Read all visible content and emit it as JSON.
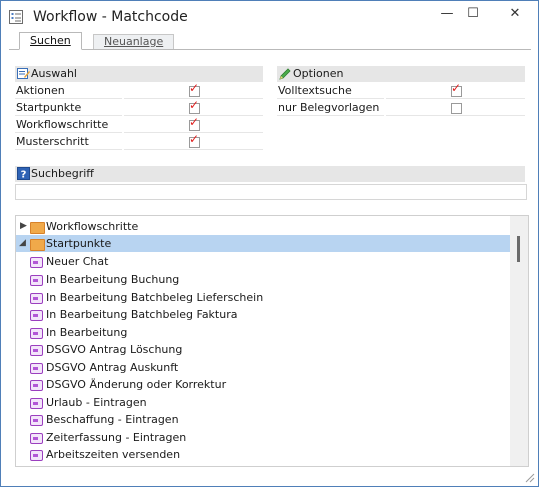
{
  "window": {
    "title": "Workflow - Matchcode"
  },
  "controls": {
    "minimize": "—",
    "maximize": "☐",
    "close": "✕"
  },
  "tabs": [
    {
      "label": "Suchen",
      "active": true
    },
    {
      "label": "Neuanlage",
      "active": false
    }
  ],
  "auswahl": {
    "title": "Auswahl",
    "icon": "edit-list-icon",
    "rows": [
      {
        "label": "Aktionen",
        "checked": true
      },
      {
        "label": "Startpunkte",
        "checked": true
      },
      {
        "label": "Workflowschritte",
        "checked": true
      },
      {
        "label": "Musterschritt",
        "checked": true
      }
    ]
  },
  "optionen": {
    "title": "Optionen",
    "icon": "pencil-icon",
    "rows": [
      {
        "label": "Volltextsuche",
        "checked": true
      },
      {
        "label": "nur Belegvorlagen",
        "checked": false
      }
    ]
  },
  "suchbegriff": {
    "title": "Suchbegriff",
    "icon": "help-icon",
    "value": ""
  },
  "tree": {
    "nodes": [
      {
        "label": "Workflowschritte",
        "type": "folder",
        "expanded": false,
        "selected": false
      },
      {
        "label": "Startpunkte",
        "type": "folder",
        "expanded": true,
        "selected": true
      },
      {
        "label": "Neuer Chat",
        "type": "leaf"
      },
      {
        "label": "In Bearbeitung Buchung",
        "type": "leaf"
      },
      {
        "label": "In Bearbeitung Batchbeleg Lieferschein",
        "type": "leaf"
      },
      {
        "label": "In Bearbeitung Batchbeleg Faktura",
        "type": "leaf"
      },
      {
        "label": "In Bearbeitung",
        "type": "leaf"
      },
      {
        "label": "DSGVO Antrag Löschung",
        "type": "leaf"
      },
      {
        "label": "DSGVO Antrag Auskunft",
        "type": "leaf"
      },
      {
        "label": "DSGVO Änderung oder Korrektur",
        "type": "leaf"
      },
      {
        "label": "Urlaub - Eintragen",
        "type": "leaf"
      },
      {
        "label": "Beschaffung - Eintragen",
        "type": "leaf"
      },
      {
        "label": "Zeiterfassung - Eintragen",
        "type": "leaf"
      },
      {
        "label": "Arbeitszeiten versenden",
        "type": "leaf"
      }
    ]
  },
  "colors": {
    "selection": "#b8d4f1",
    "check": "#e02020",
    "header": "#e6e6e6"
  }
}
